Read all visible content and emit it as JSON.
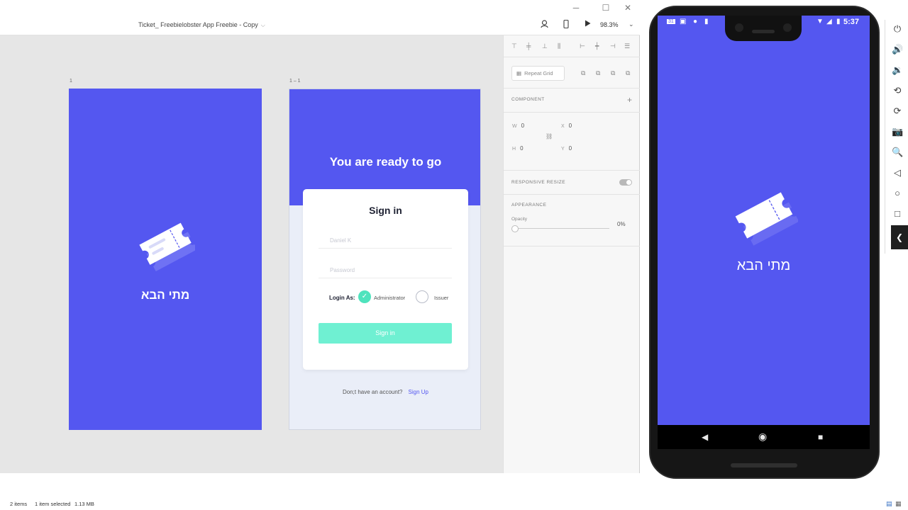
{
  "xd": {
    "document_title": "Ticket_ Freebielobster App Freebie - Copy",
    "zoom": "98.3%",
    "artboards": [
      {
        "label": "1",
        "app_name": "מתי הבא"
      },
      {
        "label": "1 – 1",
        "heading": "You are ready to go",
        "card_title": "Sign in",
        "username_placeholder": "Daniel K",
        "password_placeholder": "Password",
        "login_as_label": "Login As:",
        "role_administrator": "Administrator",
        "role_issuer": "Issuer",
        "signin_button": "Sign in",
        "no_account_text": "Don;t have an account?",
        "signup_link": "Sign Up"
      }
    ],
    "inspector": {
      "repeat_grid": "Repeat Grid",
      "component_header": "COMPONENT",
      "w_label": "W",
      "w_value": "0",
      "h_label": "H",
      "h_value": "0",
      "x_label": "X",
      "x_value": "0",
      "y_label": "Y",
      "y_value": "0",
      "responsive_resize": "RESPONSIVE RESIZE",
      "appearance": "APPEARANCE",
      "opacity_label": "Opacity",
      "opacity_value": "0%"
    }
  },
  "phone": {
    "time": "5:37",
    "app_name": "מתי הבא",
    "status_date_icon": "31"
  },
  "explorer": {
    "items": "2 items",
    "selected": "1 item selected",
    "size": "1.13 MB"
  },
  "colors": {
    "brand": "#5457f0",
    "accent": "#4fe3bd",
    "button": "#6ff0d2"
  }
}
